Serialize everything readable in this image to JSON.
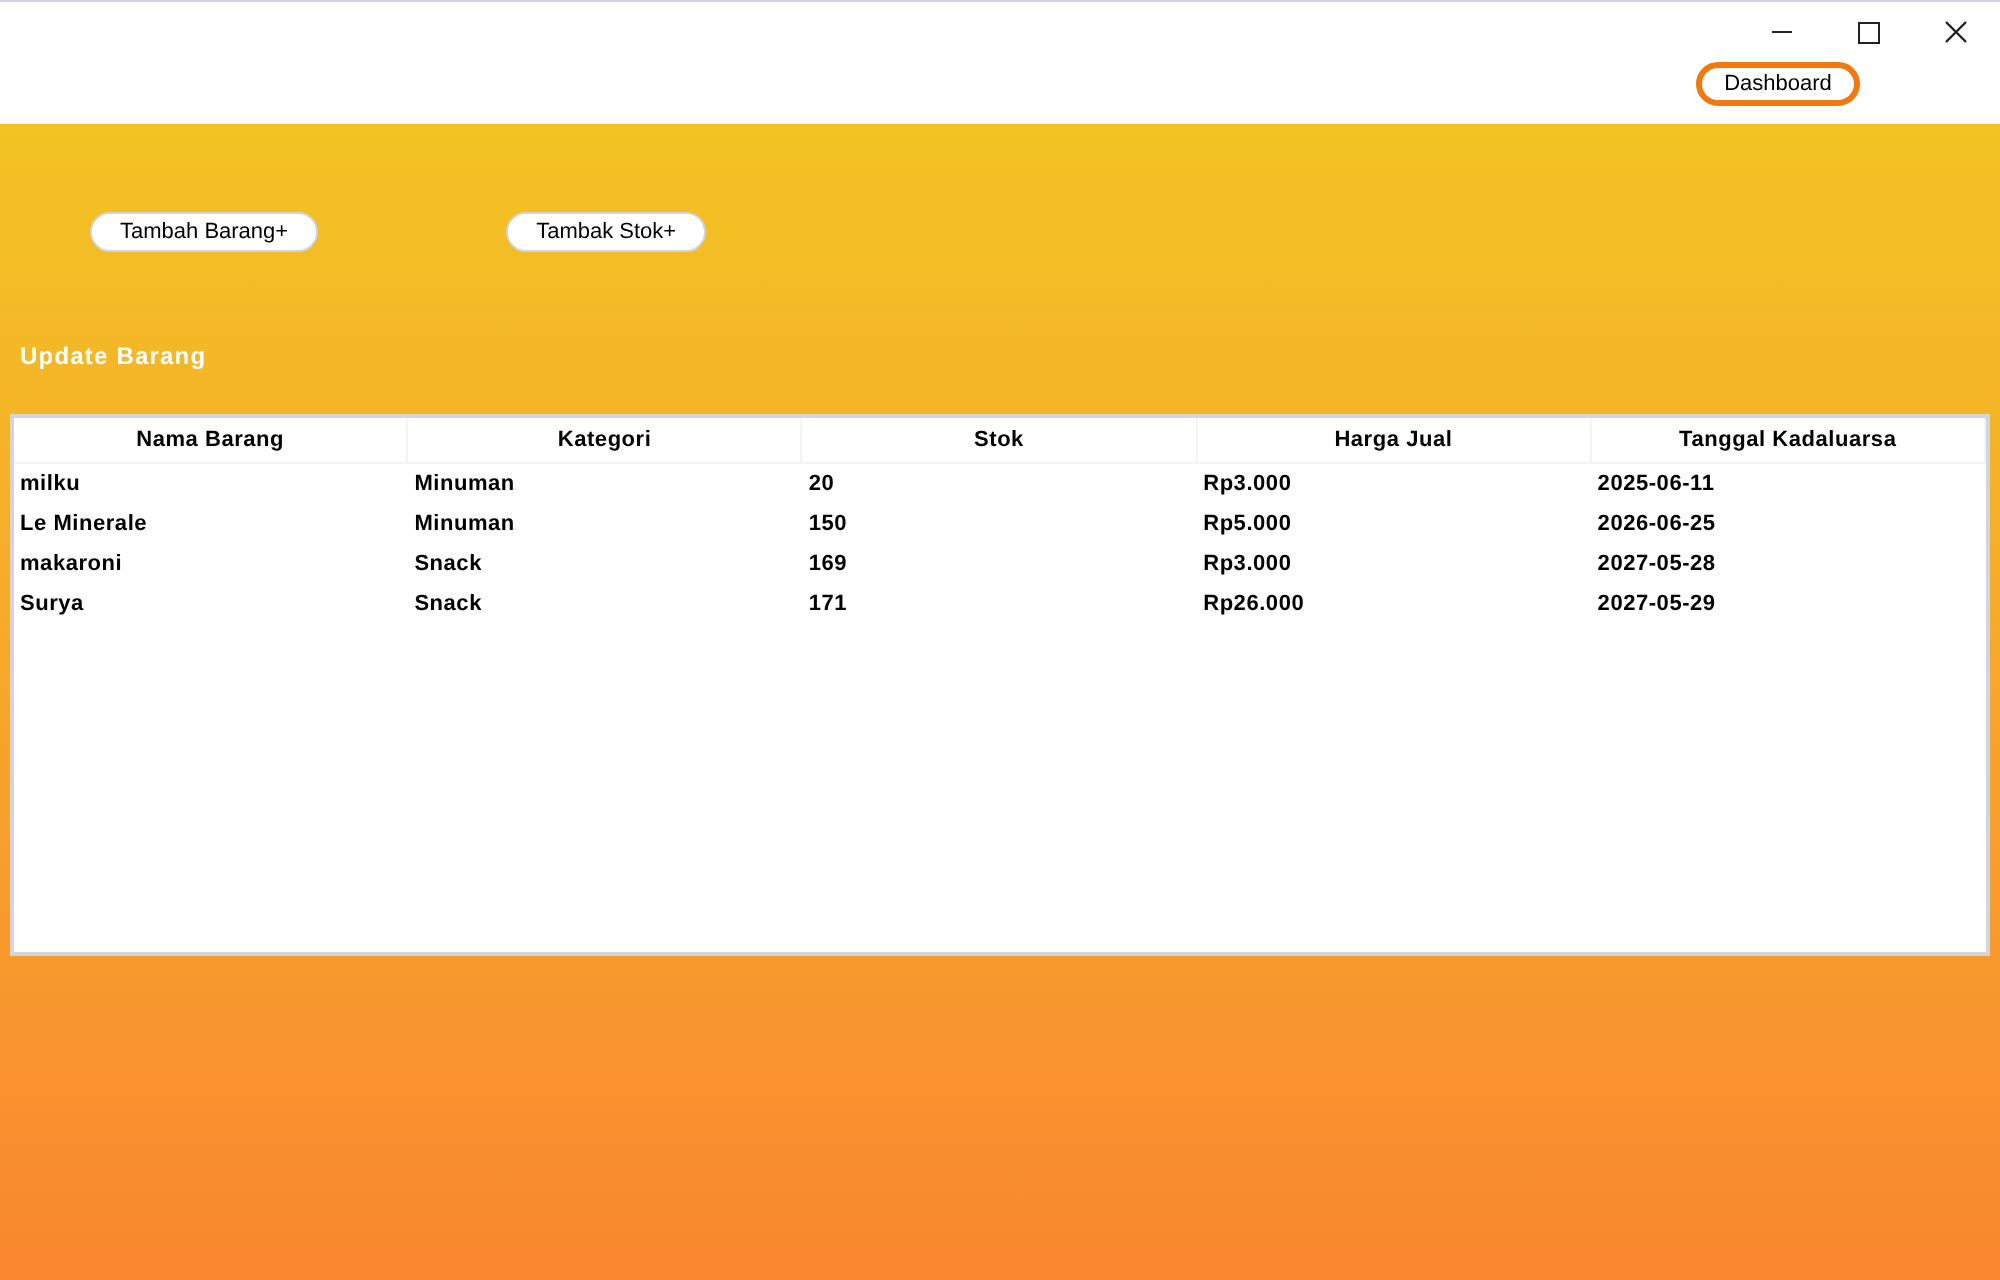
{
  "header": {
    "dashboard_button": "Dashboard"
  },
  "actions": [
    "Tambah Barang+",
    "Tambak Stok+"
  ],
  "section_title": "Update Barang",
  "table": {
    "columns": [
      "Nama Barang",
      "Kategori",
      "Stok",
      "Harga Jual",
      "Tanggal Kadaluarsa"
    ],
    "rows": [
      [
        "milku",
        "Minuman",
        "20",
        "Rp3.000",
        "2025-06-11"
      ],
      [
        "Le Minerale",
        "Minuman",
        "150",
        "Rp5.000",
        "2026-06-25"
      ],
      [
        "makaroni",
        "Snack",
        "169",
        "Rp3.000",
        "2027-05-28"
      ],
      [
        "Surya",
        "Snack",
        "171",
        "Rp26.000",
        "2027-05-29"
      ]
    ]
  }
}
